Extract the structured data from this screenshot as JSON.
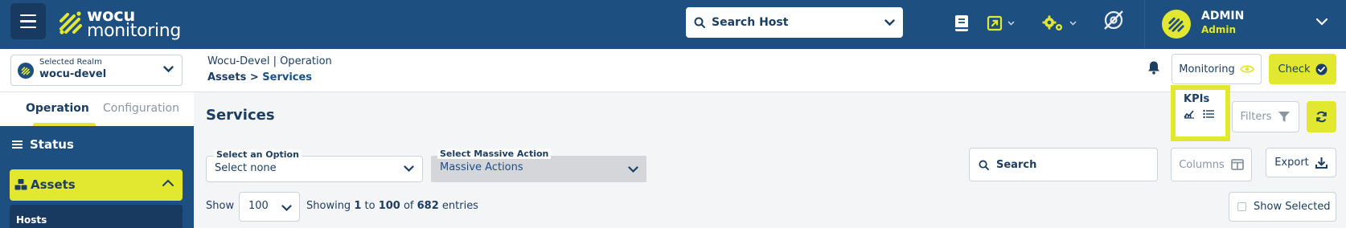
{
  "brand": {
    "line1": "wocu",
    "line2": "monitoring"
  },
  "header": {
    "search_host_placeholder": "Search Host",
    "user": {
      "name": "ADMIN",
      "role": "Admin"
    }
  },
  "realm": {
    "label": "Selected Realm",
    "value": "wocu-devel"
  },
  "breadcrumb": {
    "line1": "Wocu-Devel | Operation",
    "section": "Assets",
    "separator": " > ",
    "current": "Services"
  },
  "actions": {
    "monitoring_label": "Monitoring",
    "check_label": "Check"
  },
  "sidebar": {
    "tabs": [
      {
        "label": "Operation"
      },
      {
        "label": "Configuration"
      }
    ],
    "items": [
      {
        "label": "Status"
      },
      {
        "label": "Assets"
      },
      {
        "label": "Hosts"
      }
    ]
  },
  "main": {
    "title": "Services",
    "kpis_label": "KPIs",
    "filters_label": "Filters",
    "select_option": {
      "label": "Select an Option",
      "value": "Select none"
    },
    "select_massive": {
      "label": "Select Massive Action",
      "value": "Massive Actions"
    },
    "search_placeholder": "Search",
    "columns_label": "Columns",
    "export_label": "Export",
    "show_label": "Show",
    "page_size": "100",
    "showing": {
      "prefix": "Showing ",
      "from": "1",
      "mid": " to ",
      "to": "100",
      "of": " of ",
      "total": "682",
      "suffix": " entries"
    },
    "show_selected_label": "Show Selected"
  },
  "colors": {
    "navy": "#1e4f81",
    "accent": "#e2e82f",
    "text": "#1d3e63"
  }
}
